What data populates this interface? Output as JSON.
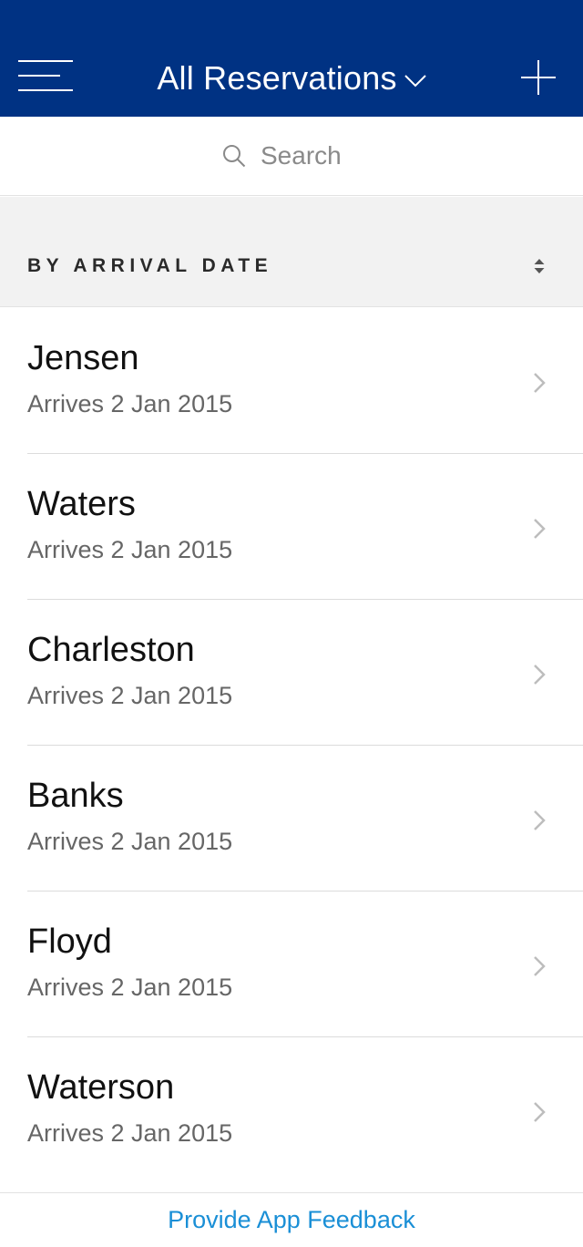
{
  "header": {
    "title": "All Reservations",
    "menu_icon": "hamburger-menu-icon",
    "dropdown_icon": "chevron-down-icon",
    "add_icon": "plus-icon",
    "background_color": "#003283"
  },
  "search": {
    "placeholder": "Search",
    "icon": "search-icon"
  },
  "section": {
    "title": "BY ARRIVAL DATE",
    "sort_icon": "sort-icon"
  },
  "reservations": [
    {
      "name": "Jensen",
      "arrival": "Arrives 2 Jan 2015"
    },
    {
      "name": "Waters",
      "arrival": "Arrives 2 Jan 2015"
    },
    {
      "name": "Charleston",
      "arrival": "Arrives 2 Jan 2015"
    },
    {
      "name": "Banks",
      "arrival": "Arrives 2 Jan 2015"
    },
    {
      "name": "Floyd",
      "arrival": "Arrives 2 Jan 2015"
    },
    {
      "name": "Waterson",
      "arrival": "Arrives 2 Jan 2015"
    }
  ],
  "footer": {
    "feedback_link": "Provide App Feedback",
    "link_color": "#1a8fd6"
  }
}
